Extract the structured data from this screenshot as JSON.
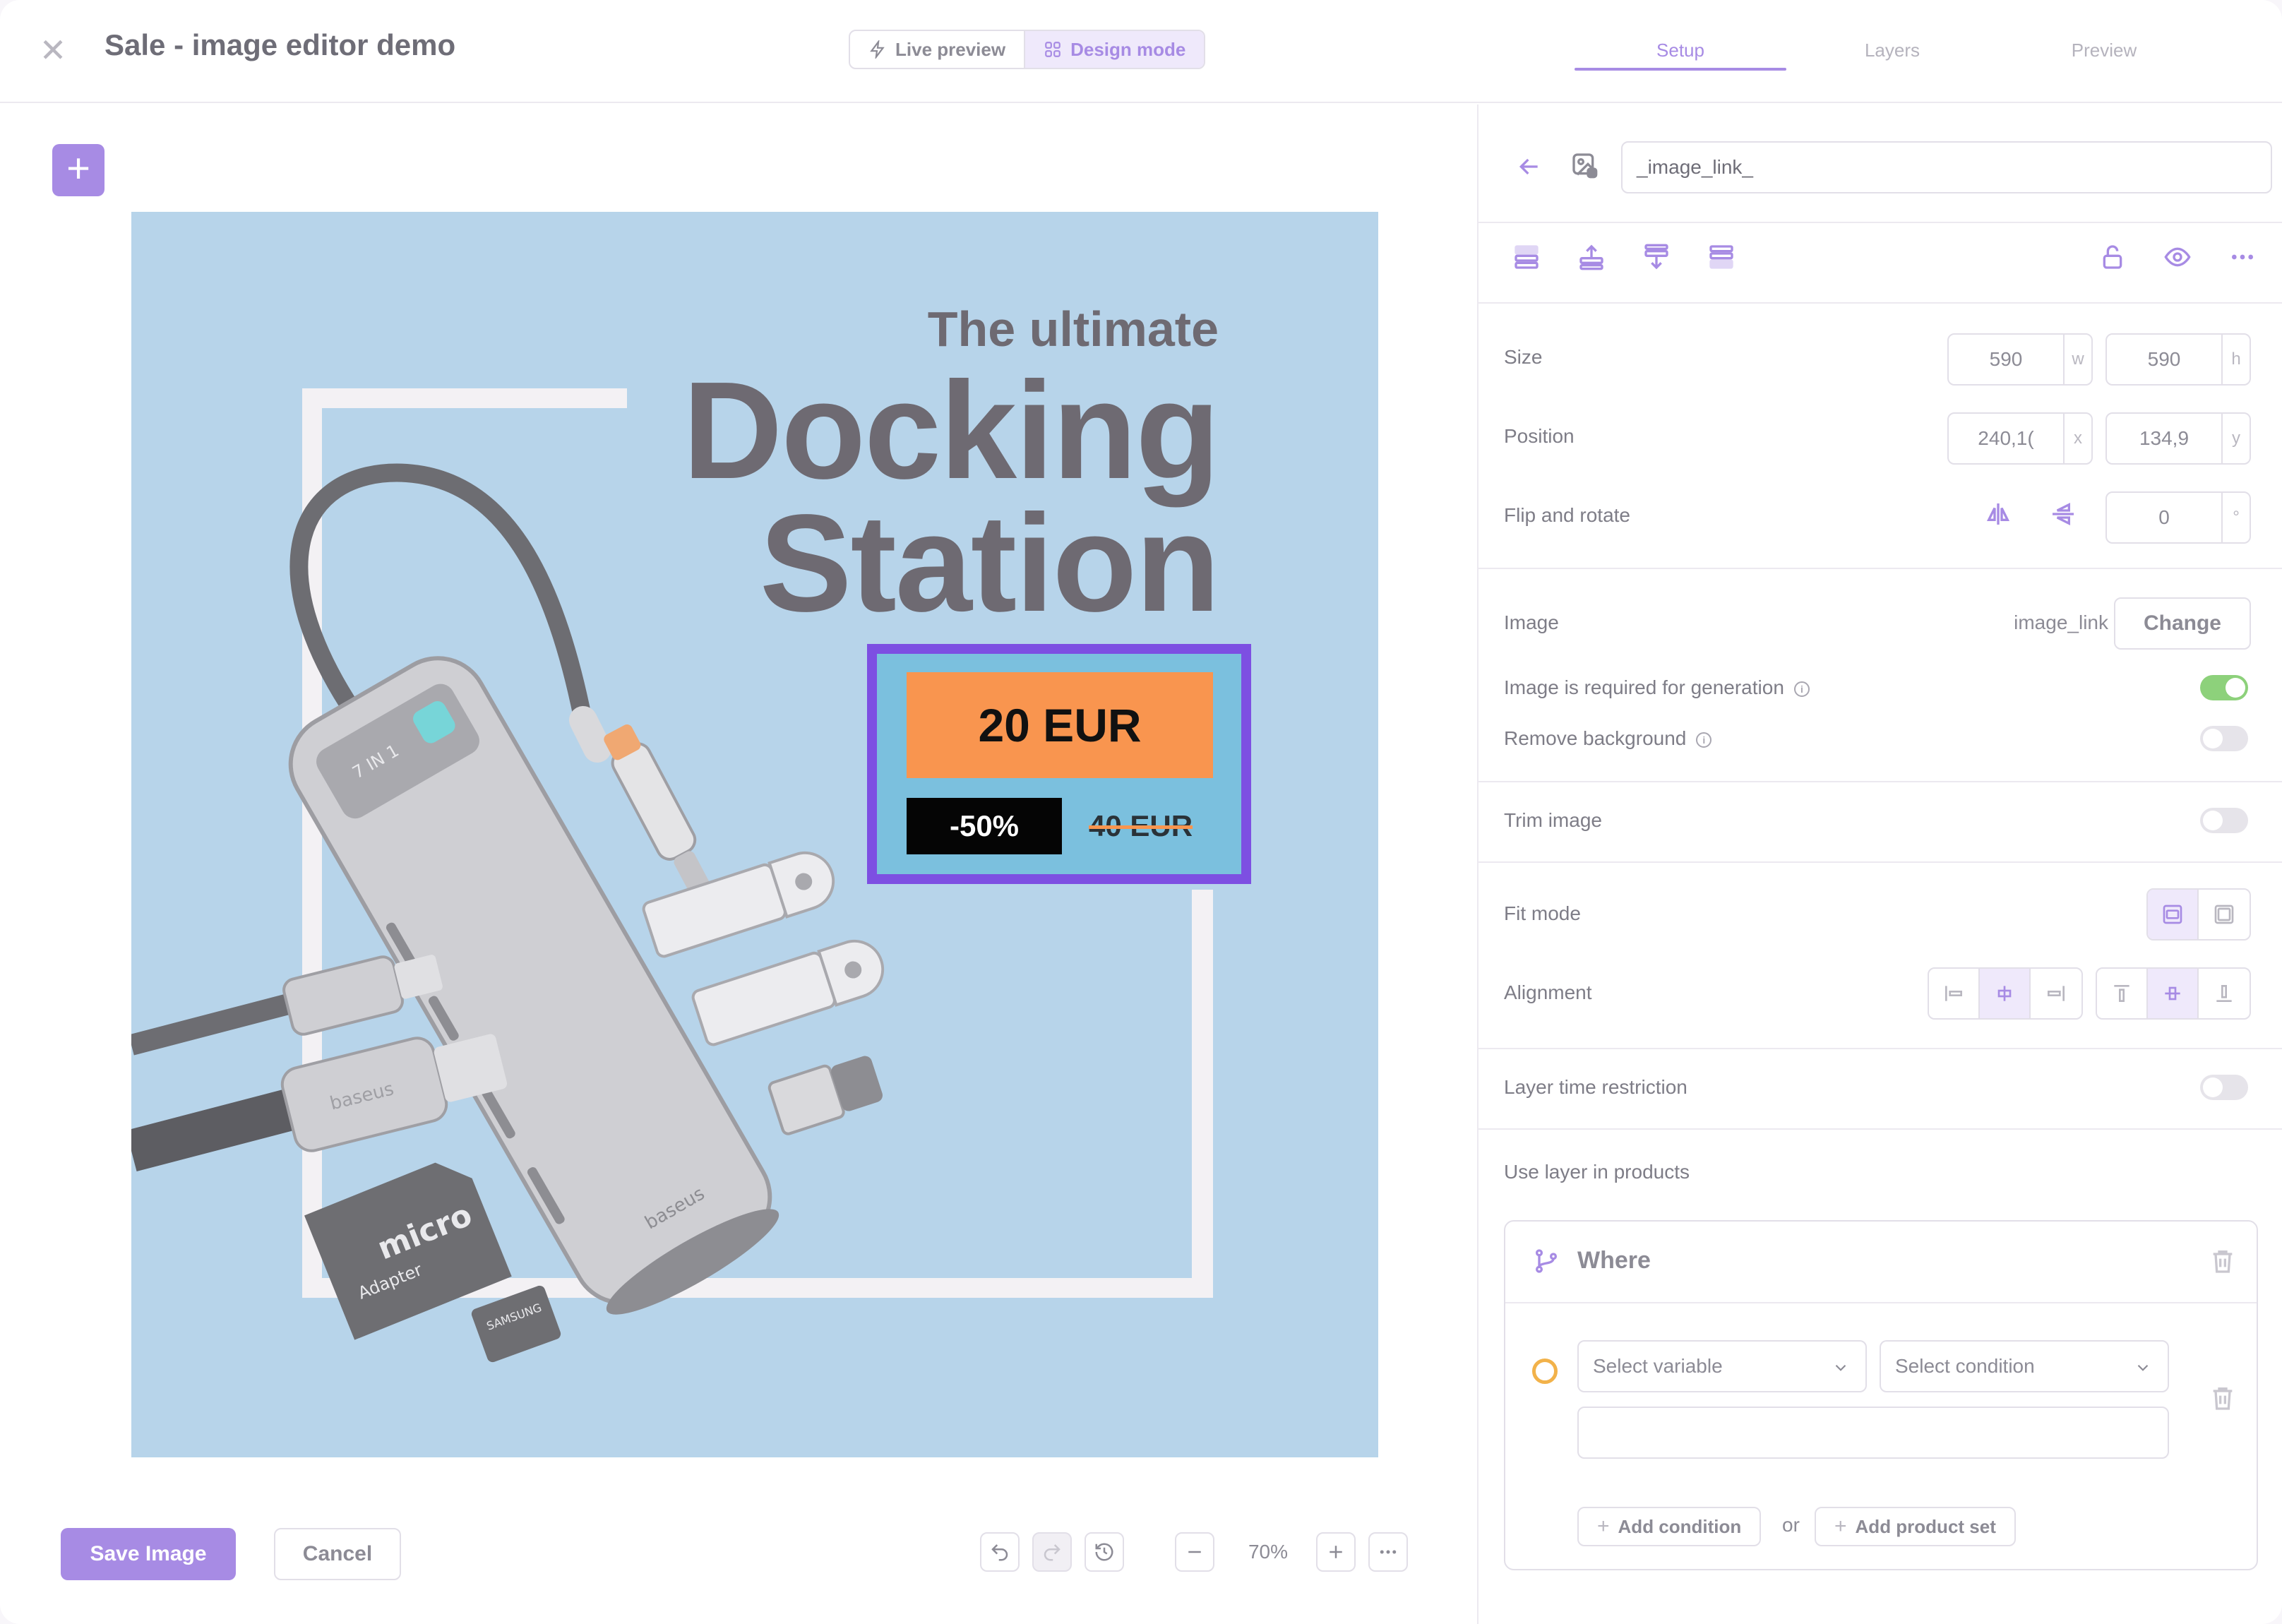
{
  "header": {
    "title": "Sale - image editor demo",
    "close_icon": "close-icon",
    "modes": [
      {
        "label": "Live preview",
        "icon": "bolt-icon"
      },
      {
        "label": "Design mode",
        "icon": "grid-icon"
      }
    ],
    "tabs": [
      "Setup",
      "Layers",
      "Preview"
    ],
    "active_tab": "Setup"
  },
  "canvas": {
    "tagline": "The ultimate",
    "headline_line1": "Docking",
    "headline_line2": "Station",
    "price": "20 EUR",
    "discount": "-50%",
    "old_price": "40 EUR",
    "background_color": "#b7d4ea",
    "price_box_color": "#7bc0de",
    "price_tag_color": "#f9954f",
    "selection_color": "#7d4fe2"
  },
  "toolbar": {
    "save_label": "Save Image",
    "cancel_label": "Cancel",
    "zoom": "70%",
    "undo_icon": "undo-icon",
    "redo_icon": "redo-icon",
    "history_icon": "history-icon",
    "zoom_out_icon": "minus-icon",
    "zoom_in_icon": "plus-icon",
    "more_icon": "more-icon"
  },
  "panel": {
    "layer_name": "_image_link_",
    "size": {
      "label": "Size",
      "w": "590",
      "w_unit": "w",
      "h": "590",
      "h_unit": "h"
    },
    "position": {
      "label": "Position",
      "x": "240,1(",
      "x_unit": "x",
      "y": "134,9",
      "y_unit": "y"
    },
    "flip": {
      "label": "Flip and rotate",
      "angle": "0",
      "angle_unit": "°"
    },
    "image": {
      "label": "Image",
      "value": "image_link",
      "change_label": "Change"
    },
    "required": {
      "label": "Image is required for generation",
      "on": true
    },
    "remove_bg": {
      "label": "Remove background",
      "on": false
    },
    "trim": {
      "label": "Trim image",
      "on": false
    },
    "fit_mode": {
      "label": "Fit mode"
    },
    "alignment": {
      "label": "Alignment"
    },
    "time_restriction": {
      "label": "Layer time restriction",
      "on": false
    },
    "use_in_products": {
      "label": "Use layer in products"
    },
    "where": {
      "title": "Where",
      "select_variable": "Select variable",
      "select_condition": "Select condition",
      "add_condition": "Add condition",
      "or_label": "or",
      "add_product_set": "Add product set"
    },
    "accent": "#a78be4"
  }
}
